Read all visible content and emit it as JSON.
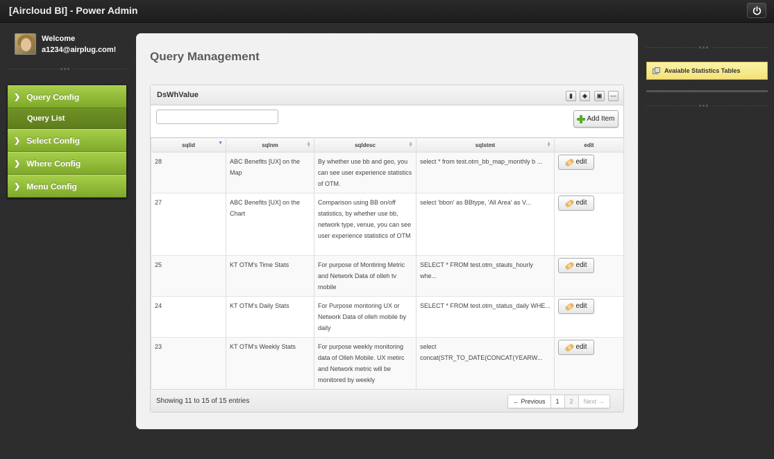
{
  "app": {
    "title": "[Aircloud BI] - Power Admin"
  },
  "user": {
    "welcome": "Welcome",
    "email": "a1234@airplug.com!"
  },
  "sidebar": {
    "items": [
      {
        "label": "Query Config",
        "icon": "chevron-right-icon",
        "sub": [
          {
            "label": "Query List"
          }
        ]
      },
      {
        "label": "Select Config",
        "icon": "chevron-right-icon"
      },
      {
        "label": "Where Config",
        "icon": "chevron-right-icon"
      },
      {
        "label": "Menu Config",
        "icon": "chevron-right-icon"
      }
    ]
  },
  "main": {
    "title": "Query Management",
    "box": {
      "title": "DsWhValue",
      "search": {
        "value": "",
        "placeholder": ""
      },
      "add_label": "Add Item",
      "columns": [
        "sqlid",
        "sqlnm",
        "sqldesc",
        "sqlstmt",
        "edit"
      ],
      "rows": [
        {
          "sqlid": "28",
          "sqlnm": "ABC Benefits [UX] on the Map",
          "sqldesc": "By whether use bb and geo, you can see user experience statistics of OTM.",
          "sqlstmt": "select * from test.otm_bb_map_monthly b ...",
          "edit": "edit"
        },
        {
          "sqlid": "27",
          "sqlnm": "ABC Benefits [UX] on the Chart",
          "sqldesc": "Comparison using BB on/off statistics, by whether use bb, network type, venue, you can see user experience statistics of OTM",
          "sqlstmt": "select 'bbon' as BBtype, 'All Area' as V...",
          "edit": "edit"
        },
        {
          "sqlid": "25",
          "sqlnm": "KT OTM's Time Stats",
          "sqldesc": "For purpose of Montiring Metric and Network Data of olleh tv mobile",
          "sqlstmt": "SELECT * FROM test.otm_stauts_hourly whe...",
          "edit": "edit"
        },
        {
          "sqlid": "24",
          "sqlnm": "KT OTM's Daily Stats",
          "sqldesc": "For Purpose montoring UX or Network Data of olleh mobile by daily",
          "sqlstmt": "SELECT * FROM test.otm_status_daily WHE...",
          "edit": "edit"
        },
        {
          "sqlid": "23",
          "sqlnm": "KT OTM's Weekly Stats",
          "sqldesc": "For purpose weekly monitoring data of Olleh Mobile. UX metirc and Network metric will be monitored by weekly",
          "sqlstmt": "select concat(STR_TO_DATE(CONCAT(YEARW...",
          "edit": "edit"
        }
      ],
      "footer": {
        "info": "Showing 11 to 15 of 15 entries",
        "prev": "← Previous",
        "pages": [
          "1",
          "2"
        ],
        "next": "Next →"
      }
    }
  },
  "right": {
    "stats_tables_label": "Avaiable Statistics Tables"
  },
  "colors": {
    "nav_green": "#8fbb35",
    "stats_yellow": "#f7ec8e",
    "panel_bg": "#f1f1f1"
  }
}
